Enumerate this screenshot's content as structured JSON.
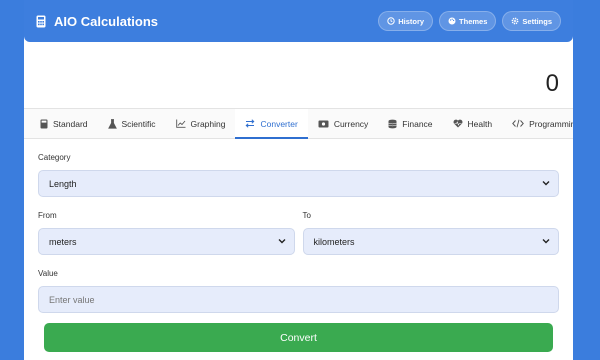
{
  "header": {
    "title": "AIO Calculations",
    "history_label": "History",
    "themes_label": "Themes",
    "settings_label": "Settings"
  },
  "display": {
    "value": "0"
  },
  "tabs": [
    {
      "label": "Standard",
      "icon": "calculator-icon"
    },
    {
      "label": "Scientific",
      "icon": "flask-icon"
    },
    {
      "label": "Graphing",
      "icon": "line-chart-icon"
    },
    {
      "label": "Converter",
      "icon": "swap-arrows-icon",
      "active": true
    },
    {
      "label": "Currency",
      "icon": "money-icon"
    },
    {
      "label": "Finance",
      "icon": "coins-icon"
    },
    {
      "label": "Health",
      "icon": "heart-pulse-icon"
    },
    {
      "label": "Programming",
      "icon": "code-icon"
    }
  ],
  "converter": {
    "category_label": "Category",
    "category_value": "Length",
    "from_label": "From",
    "from_value": "meters",
    "to_label": "To",
    "to_value": "kilometers",
    "value_label": "Value",
    "value_placeholder": "Enter value",
    "convert_label": "Convert"
  },
  "colors": {
    "accent": "#3d7ede",
    "convert": "#3aaa50",
    "field_bg": "#e6ecfb"
  }
}
